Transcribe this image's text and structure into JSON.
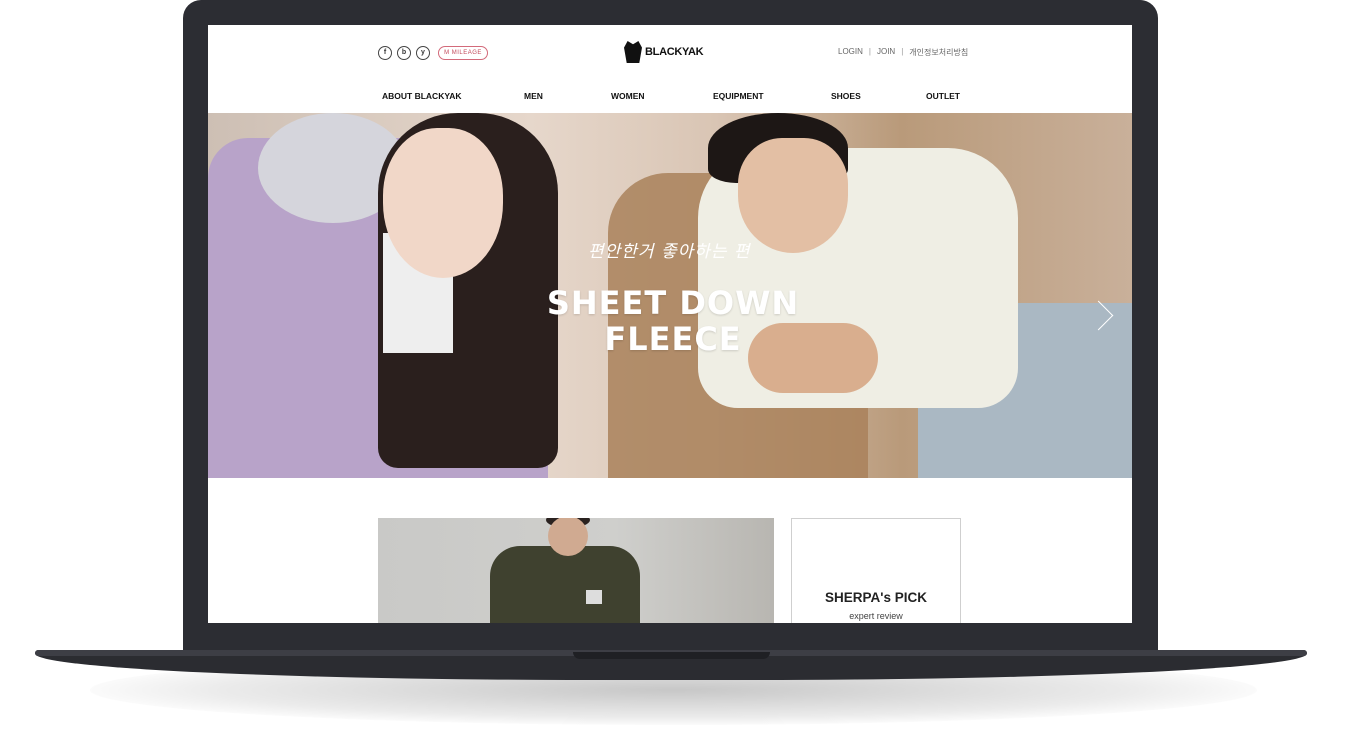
{
  "header": {
    "social_icons": [
      "f",
      "b",
      "y"
    ],
    "mileage_label": "M MILEAGE",
    "brand": "BLACKYAK",
    "top_links": [
      "LOGIN",
      "JOIN",
      "개인정보처리방침"
    ]
  },
  "nav": {
    "items": [
      "ABOUT BLACKYAK",
      "MEN",
      "WOMEN",
      "EQUIPMENT",
      "SHOES",
      "OUTLET"
    ]
  },
  "hero": {
    "korean_tagline": "편안한거 좋아하는 편",
    "title_line1": "SHEET DOWN",
    "title_line2": "FLEECE",
    "next_icon": "chevron-right-icon"
  },
  "sherpa_card": {
    "title": "SHERPA's PICK",
    "subtitle": "expert review"
  },
  "colors": {
    "device_frame": "#2c2d33",
    "mileage_accent": "#c2485a"
  }
}
